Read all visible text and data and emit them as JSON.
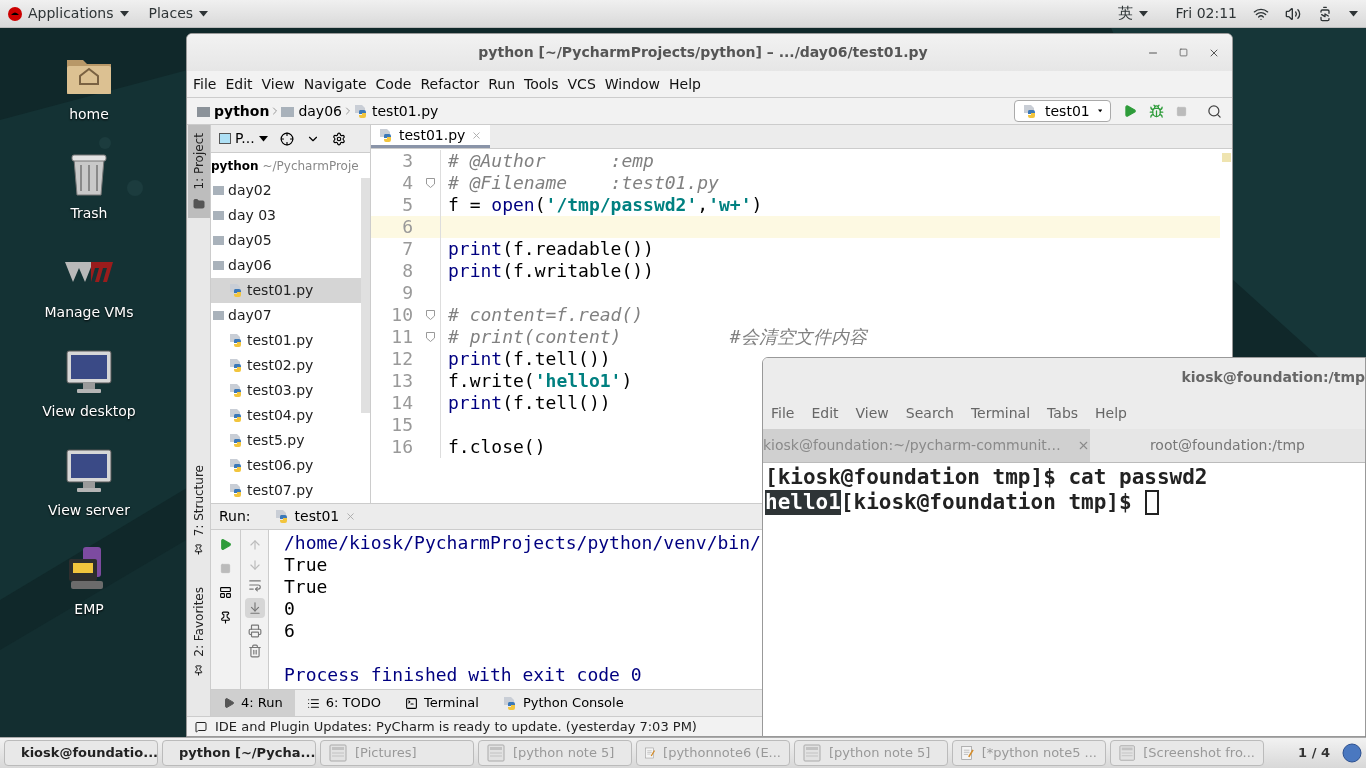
{
  "top_bar": {
    "menus": [
      "Applications",
      "Places"
    ],
    "input_method": "英",
    "clock": "Fri 02:11"
  },
  "desktop_icons": [
    {
      "label": "home",
      "kind": "home"
    },
    {
      "label": "Trash",
      "kind": "trash"
    },
    {
      "label": "Manage VMs",
      "kind": "vm"
    },
    {
      "label": "View desktop",
      "kind": "monitor"
    },
    {
      "label": "View server",
      "kind": "monitor"
    },
    {
      "label": "EMP",
      "kind": "app"
    }
  ],
  "pycharm": {
    "title": "python [~/PycharmProjects/python] – .../day06/test01.py",
    "menu": [
      "File",
      "Edit",
      "View",
      "Navigate",
      "Code",
      "Refactor",
      "Run",
      "Tools",
      "VCS",
      "Window",
      "Help"
    ],
    "breadcrumbs": [
      {
        "label": "python",
        "kind": "project"
      },
      {
        "label": "day06",
        "kind": "folder"
      },
      {
        "label": "test01.py",
        "kind": "file"
      }
    ],
    "run_config": "test01",
    "side_tabs": [
      {
        "label": "1: Project",
        "selected": true
      },
      {
        "label": "7: Structure",
        "selected": false
      },
      {
        "label": "2: Favorites",
        "selected": false
      }
    ],
    "project_view": "P...",
    "tree": {
      "label": "python",
      "path": "~/PycharmProje",
      "children": [
        {
          "label": "day02",
          "kind": "folder",
          "selected": false
        },
        {
          "label": "day 03",
          "kind": "folder",
          "selected": false
        },
        {
          "label": "day05",
          "kind": "folder",
          "selected": false
        },
        {
          "label": "day06",
          "kind": "folder",
          "selected": false,
          "children": [
            {
              "label": "test01.py",
              "kind": "file",
              "selected": true
            }
          ]
        },
        {
          "label": "day07",
          "kind": "folder",
          "selected": false,
          "children": [
            {
              "label": "test01.py",
              "kind": "file",
              "selected": false
            },
            {
              "label": "test02.py",
              "kind": "file",
              "selected": false
            },
            {
              "label": "test03.py",
              "kind": "file",
              "selected": false
            },
            {
              "label": "test04.py",
              "kind": "file",
              "selected": false
            },
            {
              "label": "test5.py",
              "kind": "file",
              "selected": false
            },
            {
              "label": "test06.py",
              "kind": "file",
              "selected": false
            },
            {
              "label": "test07.py",
              "kind": "file",
              "selected": false
            }
          ]
        }
      ]
    },
    "editor_tabs": [
      {
        "label": "test01.py",
        "selected": true
      }
    ],
    "code": [
      {
        "number": "3",
        "fold": false,
        "current": false,
        "segments": [
          {
            "kind": "comment",
            "text": "# @Author      :emp"
          }
        ]
      },
      {
        "number": "4",
        "fold": true,
        "current": false,
        "segments": [
          {
            "kind": "comment",
            "text": "# @Filename    :test01.py"
          }
        ]
      },
      {
        "number": "5",
        "fold": false,
        "current": false,
        "segments": [
          {
            "kind": "plain",
            "text": "f = "
          },
          {
            "kind": "builtin",
            "text": "open"
          },
          {
            "kind": "plain",
            "text": "("
          },
          {
            "kind": "string",
            "text": "'/tmp/passwd2'"
          },
          {
            "kind": "plain",
            "text": ","
          },
          {
            "kind": "string",
            "text": "'w+'"
          },
          {
            "kind": "plain",
            "text": ")"
          }
        ]
      },
      {
        "number": "6",
        "fold": false,
        "current": true
      },
      {
        "number": "7",
        "fold": false,
        "current": false,
        "segments": [
          {
            "kind": "builtin",
            "text": "print"
          },
          {
            "kind": "plain",
            "text": "(f.readable())"
          }
        ]
      },
      {
        "number": "8",
        "fold": false,
        "current": false,
        "segments": [
          {
            "kind": "builtin",
            "text": "print"
          },
          {
            "kind": "plain",
            "text": "(f.writable())"
          }
        ]
      },
      {
        "number": "9",
        "fold": false,
        "current": false
      },
      {
        "number": "10",
        "fold": true,
        "current": false,
        "segments": [
          {
            "kind": "comment",
            "text": "# content=f.read()"
          }
        ]
      },
      {
        "number": "11",
        "fold": true,
        "current": false,
        "segments": [
          {
            "kind": "comment",
            "text": "# print(content)          #会清空文件内容"
          }
        ]
      },
      {
        "number": "12",
        "fold": false,
        "current": false,
        "segments": [
          {
            "kind": "builtin",
            "text": "print"
          },
          {
            "kind": "plain",
            "text": "(f.tell())"
          }
        ]
      },
      {
        "number": "13",
        "fold": false,
        "current": false,
        "segments": [
          {
            "kind": "plain",
            "text": "f.write("
          },
          {
            "kind": "string",
            "text": "'hello1'"
          },
          {
            "kind": "plain",
            "text": ")"
          }
        ]
      },
      {
        "number": "14",
        "fold": false,
        "current": false,
        "segments": [
          {
            "kind": "builtin",
            "text": "print"
          },
          {
            "kind": "plain",
            "text": "(f.tell())"
          }
        ]
      },
      {
        "number": "15",
        "fold": false,
        "current": false
      },
      {
        "number": "16",
        "fold": false,
        "current": false,
        "segments": [
          {
            "kind": "plain",
            "text": "f.close()"
          }
        ]
      }
    ],
    "run": {
      "label": "Run:",
      "tab": "test01",
      "scroll_to_end": true,
      "output": [
        {
          "kind": "system",
          "text": "/home/kiosk/PycharmProjects/python/venv/bin/"
        },
        {
          "kind": "plain",
          "text": "True"
        },
        {
          "kind": "plain",
          "text": "True"
        },
        {
          "kind": "plain",
          "text": "0"
        },
        {
          "kind": "plain",
          "text": "6"
        },
        {
          "kind": "blank"
        },
        {
          "kind": "system",
          "text": "Process finished with exit code 0"
        }
      ]
    },
    "bottom_tabs": [
      {
        "label": "4: Run",
        "kind": "run",
        "selected": true
      },
      {
        "label": "6: TODO",
        "kind": "todo",
        "selected": false
      },
      {
        "label": "Terminal",
        "kind": "terminal",
        "selected": false
      },
      {
        "label": "Python Console",
        "kind": "console",
        "selected": false
      }
    ],
    "status": "IDE and Plugin Updates: PyCharm is ready to update. (yesterday 7:03 PM)"
  },
  "terminal": {
    "title": "kiosk@foundation:/tmp",
    "menu": [
      "File",
      "Edit",
      "View",
      "Search",
      "Terminal",
      "Tabs",
      "Help"
    ],
    "tabs": [
      {
        "label": "kiosk@foundation:~/pycharm-communit…",
        "selected": false,
        "closable": true
      },
      {
        "label": "root@foundation:/tmp",
        "selected": true,
        "closable": false
      }
    ],
    "lines": [
      {
        "cursor": false,
        "segments": [
          {
            "text": "[kiosk@foundation tmp]$ cat passwd2",
            "selected": false
          }
        ]
      },
      {
        "cursor": true,
        "segments": [
          {
            "text": "hello1",
            "selected": true
          },
          {
            "text": "[kiosk@foundation tmp]$",
            "selected": false
          }
        ]
      }
    ]
  },
  "taskbar": {
    "items": [
      {
        "label": "kiosk@foundatio...",
        "kind": "terminal",
        "minimized": false
      },
      {
        "label": "python [~/Pycha...",
        "kind": "pycharm",
        "minimized": false
      },
      {
        "label": "[Pictures]",
        "kind": "window",
        "minimized": true
      },
      {
        "label": "[python note 5]",
        "kind": "window",
        "minimized": true
      },
      {
        "label": "[pythonnote6 (E...",
        "kind": "editor",
        "minimized": true
      },
      {
        "label": "[python note 5]",
        "kind": "window",
        "minimized": true
      },
      {
        "label": "[*python note5 ...",
        "kind": "editor",
        "minimized": true
      },
      {
        "label": "[Screenshot fro...",
        "kind": "window",
        "minimized": true
      }
    ],
    "pager": "1 / 4"
  }
}
